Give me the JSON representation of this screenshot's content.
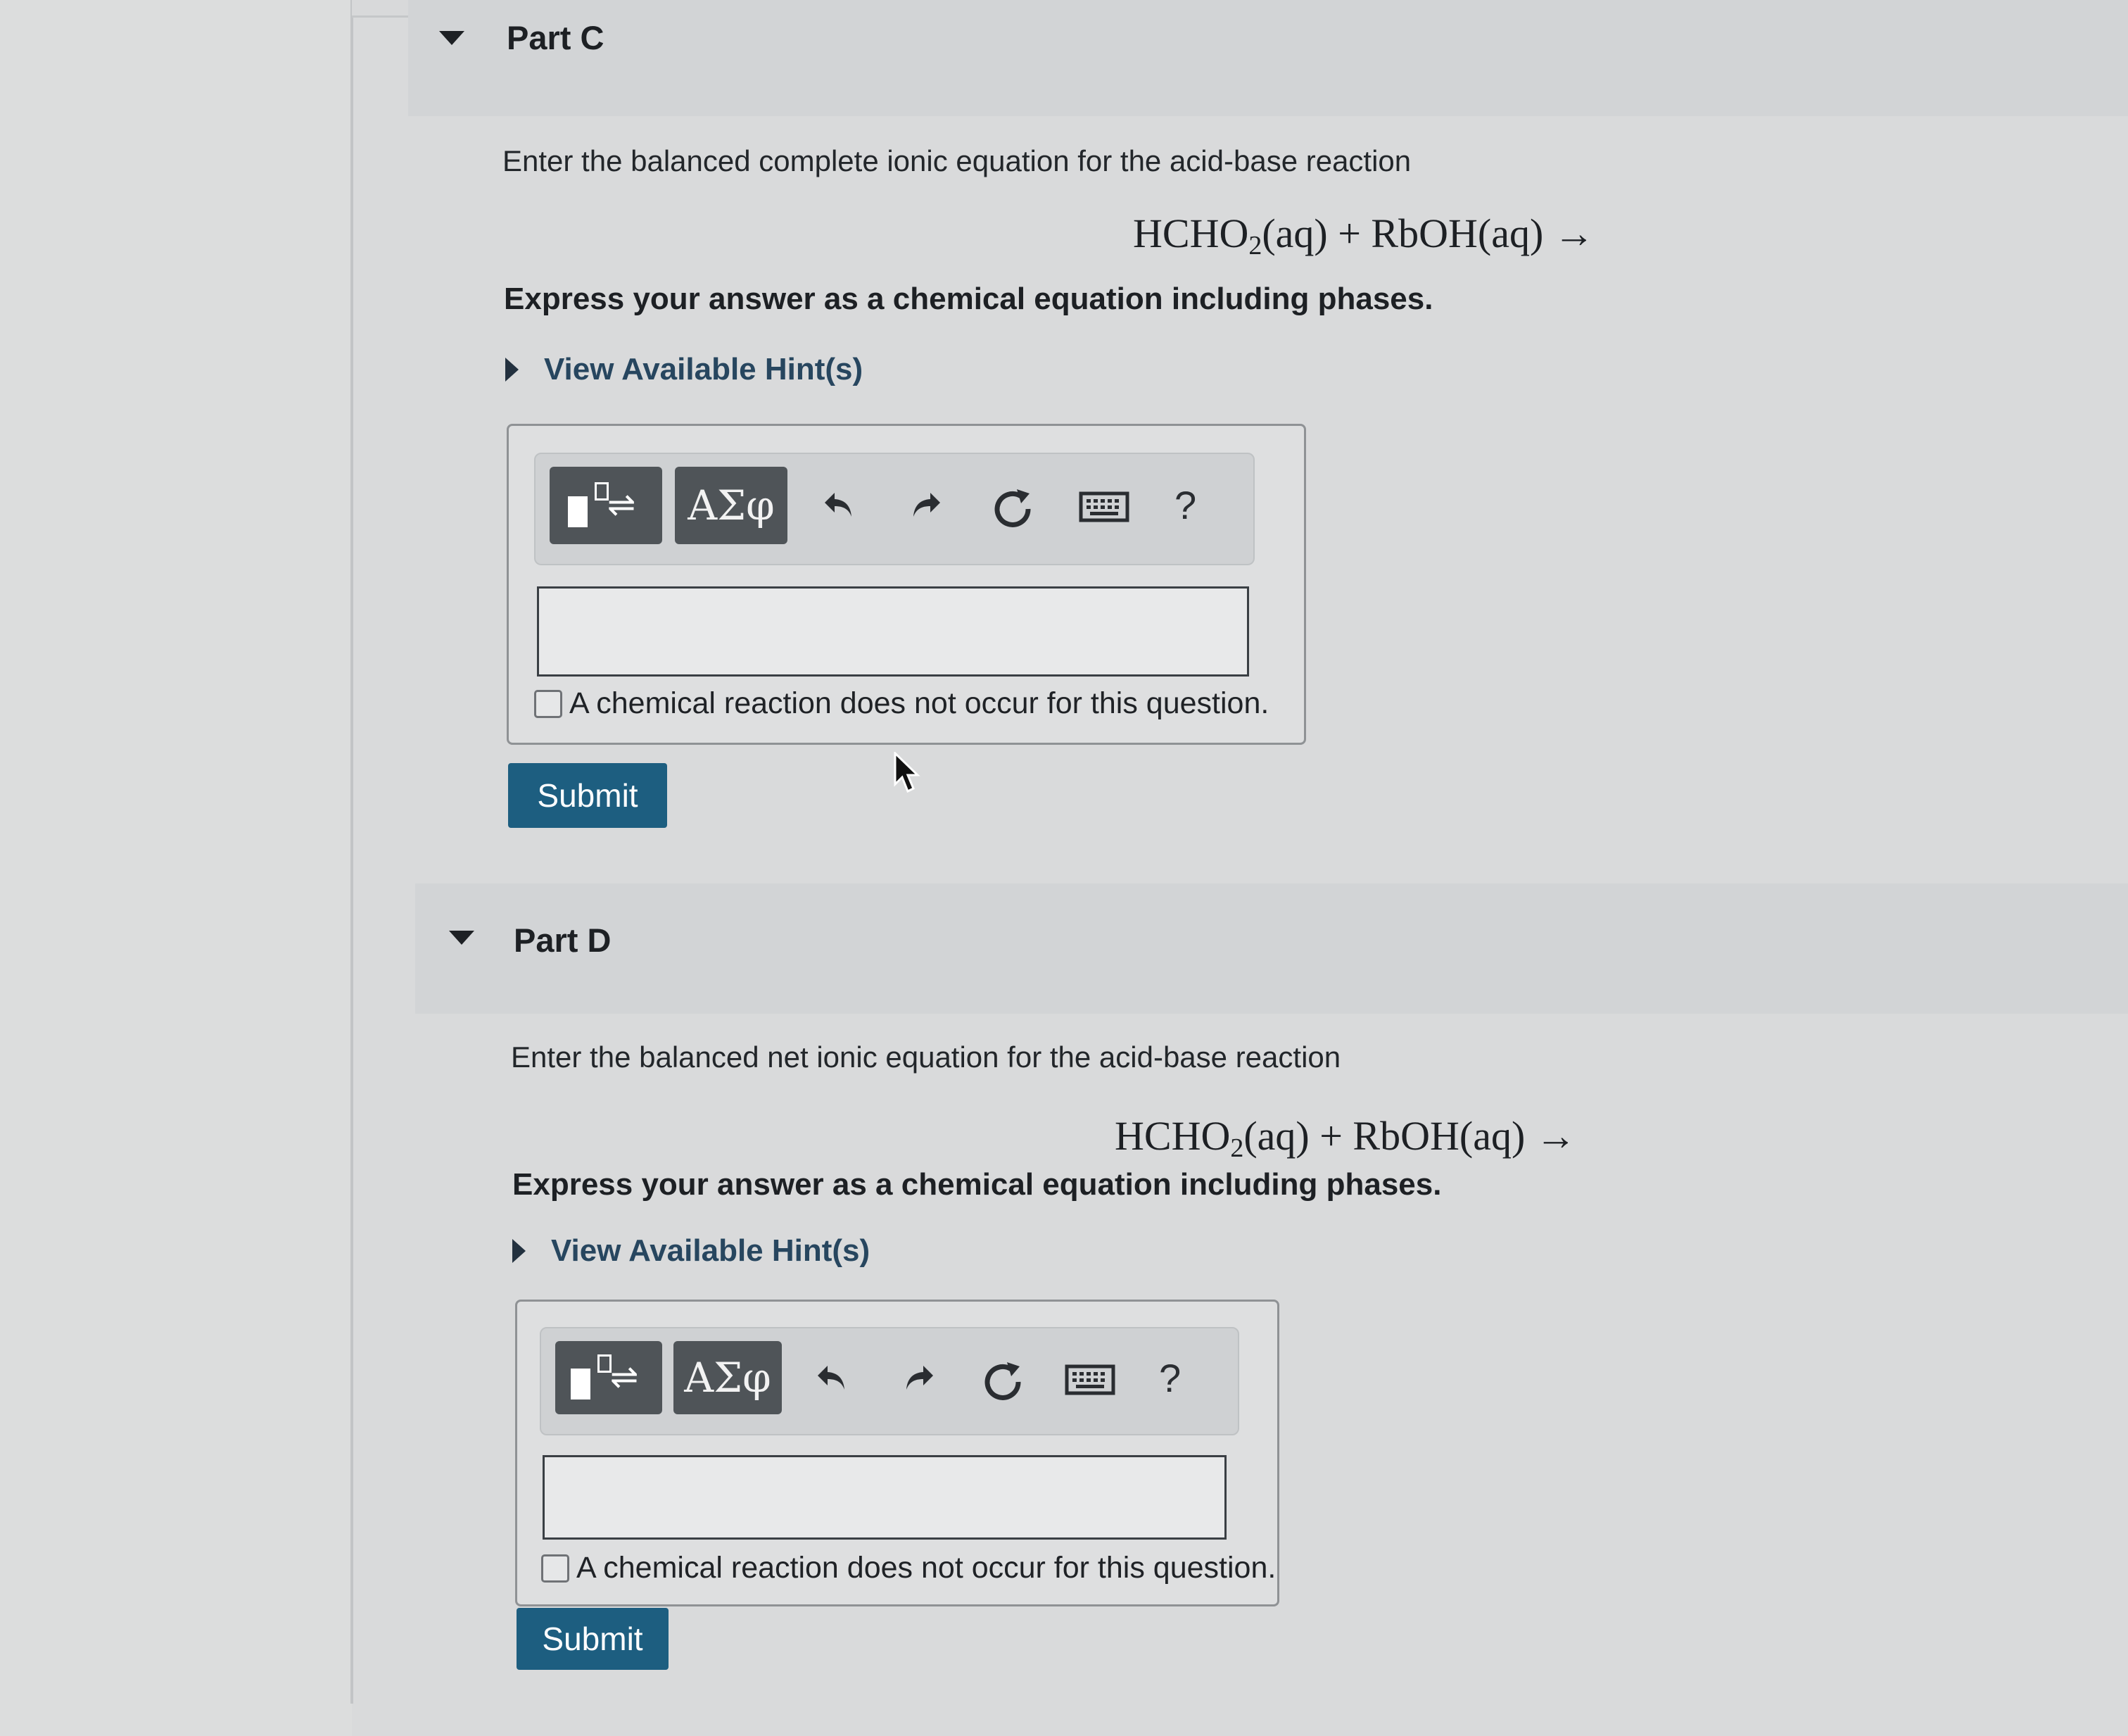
{
  "part_c": {
    "title": "Part C",
    "prompt": "Enter the balanced complete ionic equation for the acid-base reaction",
    "equation": {
      "lhs": "HCHO",
      "subscript": "2",
      "rhs": "(aq) + RbOH(aq) →"
    },
    "instruction": "Express your answer as a chemical equation including phases.",
    "hint_label": "View Available Hint(s)",
    "toolbar": {
      "greek_label": "ΑΣφ",
      "help_label": "?"
    },
    "answer_value": "",
    "no_reaction_label": "A chemical reaction does not occur for this question.",
    "submit_label": "Submit"
  },
  "part_d": {
    "title": "Part D",
    "prompt": "Enter the balanced net ionic equation for the acid-base reaction",
    "equation": {
      "lhs": "HCHO",
      "subscript": "2",
      "rhs": "(aq) + RbOH(aq) →"
    },
    "instruction": "Express your answer as a chemical equation including phases.",
    "hint_label": "View Available Hint(s)",
    "toolbar": {
      "greek_label": "ΑΣφ",
      "help_label": "?"
    },
    "answer_value": "",
    "no_reaction_label": "A chemical reaction does not occur for this question.",
    "submit_label": "Submit"
  },
  "icons": [
    "template-icon",
    "undo-icon",
    "redo-icon",
    "reset-icon",
    "keyboard-icon",
    "help-icon",
    "mouse-cursor-icon"
  ]
}
